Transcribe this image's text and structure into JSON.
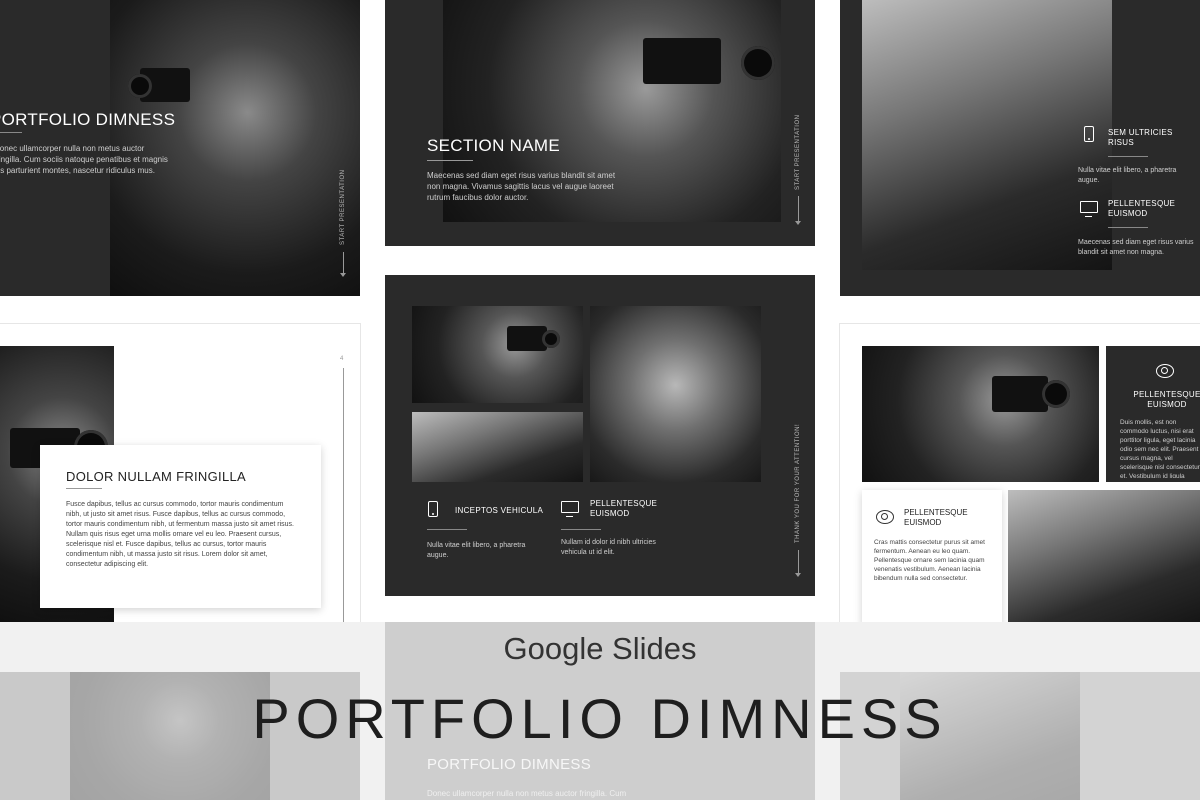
{
  "slide1": {
    "title": "PORTFOLIO DIMNESS",
    "body": "Donec ullamcorper nulla non metus auctor fringilla. Cum sociis natoque penatibus et magnis dis parturient montes, nascetur ridiculus mus.",
    "side_text": "START PRESENTATION"
  },
  "slide2": {
    "title": "SECTION NAME",
    "body": "Maecenas sed diam eget risus varius blandit sit amet non magna. Vivamus sagittis lacus vel augue laoreet rutrum faucibus dolor auctor.",
    "side_text": "START PRESENTATION"
  },
  "slide3": {
    "item1_title": "SEM ULTRICIES RISUS",
    "item1_body": "Nulla vitae elit libero, a pharetra augue.",
    "item2_title": "PELLENTESQUE EUISMOD",
    "item2_body": "Maecenas sed diam eget risus varius blandit sit amet non magna."
  },
  "slide4": {
    "title": "DOLOR NULLAM FRINGILLA",
    "body": "Fusce dapibus, tellus ac cursus commodo, tortor mauris condimentum nibh, ut justo sit amet risus. Fusce dapibus, tellus ac cursus commodo, tortor mauris condimentum nibh, ut fermentum massa justo sit amet risus. Nullam quis risus eget urna mollis ornare vel eu leo. Praesent cursus, scelerisque nisl et. Fusce dapibus, tellus ac cursus, tortor mauris condimentum nibh, ut massa justo sit risus. Lorem dolor sit amet, consectetur adipiscing elit.",
    "page_number": "4"
  },
  "slide5": {
    "item1_title": "INCEPTOS VEHICULA",
    "item1_body": "Nulla vitae elit libero, a pharetra augue.",
    "item2_title": "PELLENTESQUE EUISMOD",
    "item2_body": "Nullam id dolor id nibh ultricies vehicula ut id elit.",
    "side_text": "THANK YOU FOR YOUR ATTENTION!"
  },
  "slide6": {
    "panel_title": "PELLENTESQUE EUISMOD",
    "panel_body": "Duis mollis, est non commodo luctus, nisi erat porttitor ligula, eget lacinia odio sem nec elit. Praesent cursus magna, vel scelerisque nisl consectetur et. Vestibulum id ligula porta felis euismod semper.",
    "card_title": "PELLENTESQUE EUISMOD",
    "card_body": "Cras mattis consectetur purus sit amet fermentum. Aenean eu leo quam. Pellentesque ornare sem lacinia quam venenatis vestibulum. Aenean lacinia bibendum nulla sed consectetur."
  },
  "bottom_slide": {
    "title": "PORTFOLIO DIMNESS",
    "body": "Donec ullamcorper nulla non metus auctor fringilla. Cum"
  },
  "banner": {
    "subtitle": "Google Slides",
    "title": "PORTFOLIO DIMNESS"
  }
}
